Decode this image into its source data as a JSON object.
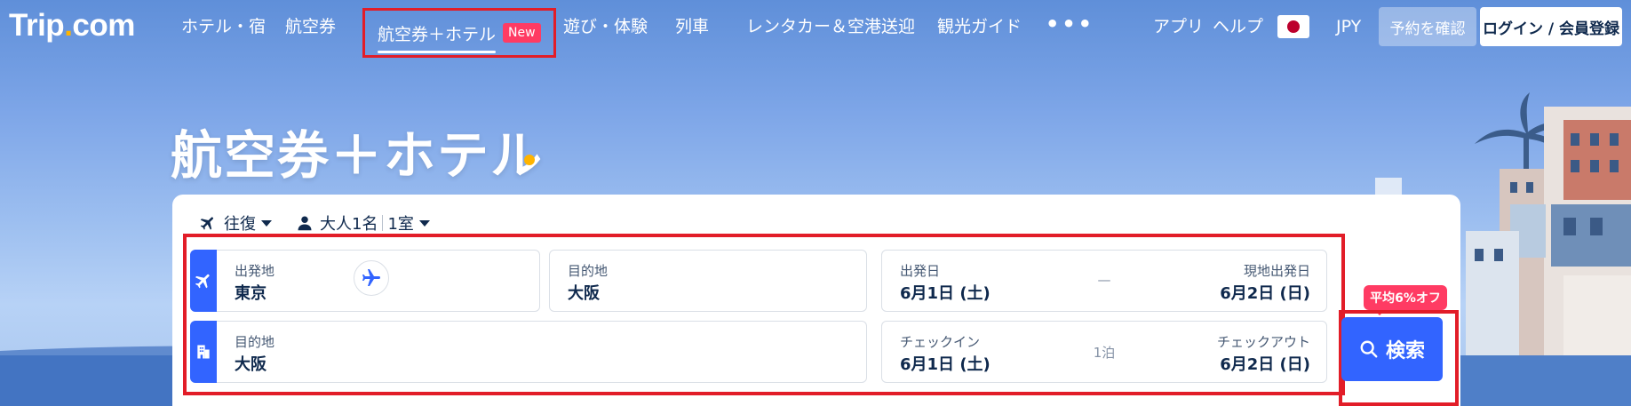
{
  "brand": {
    "logo_main": "Trip",
    "logo_dot": ".",
    "logo_tail": "com"
  },
  "nav": {
    "hotel": "ホテル・宿",
    "flights": "航空券",
    "flight_hotel": "航空券＋ホテル",
    "new_badge": "New",
    "activities": "遊び・体験",
    "trains": "列車",
    "cars": "レンタカー＆空港送迎",
    "guide": "観光ガイド",
    "more": "•••"
  },
  "header_right": {
    "app": "アプリ",
    "help": "ヘルプ",
    "currency": "JPY",
    "check_reservation": "予約を確認",
    "login": "ログイン / 会員登録"
  },
  "hero": {
    "title": "航空券＋ホテル"
  },
  "search": {
    "trip_type": "往復",
    "travelers": "大人1名",
    "rooms": "1室",
    "flight_row": {
      "origin_label": "出発地",
      "origin_value": "東京",
      "dest_label": "目的地",
      "dest_value": "大阪",
      "depart_label": "出発日",
      "depart_value": "6月1日 (土)",
      "dash": "—",
      "return_label": "現地出発日",
      "return_value": "6月2日 (日)"
    },
    "hotel_row": {
      "dest_label": "目的地",
      "dest_value": "大阪",
      "checkin_label": "チェックイン",
      "checkin_value": "6月1日 (土)",
      "nights": "1泊",
      "checkout_label": "チェックアウト",
      "checkout_value": "6月2日 (日)"
    },
    "discount_badge": "平均6%オフ",
    "search_button": "検索"
  },
  "colors": {
    "accent_blue": "#3264ff",
    "highlight_red": "#e21d28",
    "badge_pink": "#ff3b63",
    "logo_dot_yellow": "#ffb400",
    "text_dark": "#0f294d"
  },
  "icons": [
    "plane-icon",
    "person-icon",
    "hotel-building-icon",
    "swap-plane-icon",
    "search-icon",
    "japan-flag-icon"
  ]
}
